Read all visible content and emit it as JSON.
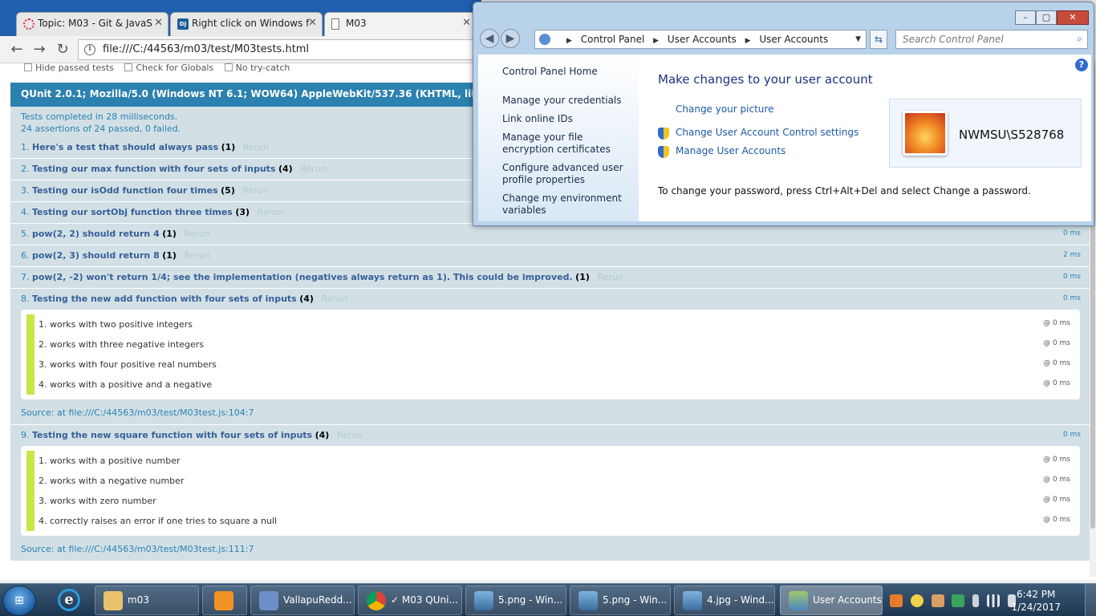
{
  "browser": {
    "tabs": [
      {
        "title": "Topic: M03 - Git & JavaS",
        "icon": "spinner-icon"
      },
      {
        "title": "Right click on Windows f",
        "icon": "dj-icon"
      },
      {
        "title": "M03",
        "icon": "page-icon"
      }
    ],
    "url": "file:///C:/44563/m03/test/M03tests.html"
  },
  "qunit": {
    "options": [
      "Hide passed tests",
      "Check for Globals",
      "No try-catch"
    ],
    "user_agent": "QUnit 2.0.1; Mozilla/5.0 (Windows NT 6.1; WOW64) AppleWebKit/537.36 (KHTML, like Gecko) Chrome/5",
    "result_line1": "Tests completed in 28 milliseconds.",
    "result_line2": "24 assertions of 24 passed, 0 failed.",
    "rerun_label": "Rerun",
    "tests": [
      {
        "idx": "1.",
        "name": "Here's a test that should always pass",
        "count": "(1)",
        "time": ""
      },
      {
        "idx": "2.",
        "name": "Testing our max function with four sets of inputs",
        "count": "(4)",
        "time": ""
      },
      {
        "idx": "3.",
        "name": "Testing our isOdd function four times",
        "count": "(5)",
        "time": ""
      },
      {
        "idx": "4.",
        "name": "Testing our sortObj function three times",
        "count": "(3)",
        "time": ""
      },
      {
        "idx": "5.",
        "name": "pow(2, 2) should return 4",
        "count": "(1)",
        "time": "0 ms"
      },
      {
        "idx": "6.",
        "name": "pow(2, 3) should return 8",
        "count": "(1)",
        "time": "2 ms"
      },
      {
        "idx": "7.",
        "name": "pow(2, -2) won't return 1/4; see the implementation (negatives always return as 1). This could be improved.",
        "count": "(1)",
        "time": "0 ms"
      },
      {
        "idx": "8.",
        "name": "Testing the new add function with four sets of inputs",
        "count": "(4)",
        "time": "0 ms",
        "assertions": [
          {
            "text": "1. works with two positive integers",
            "at": "@ 0 ms"
          },
          {
            "text": "2. works with three negative integers",
            "at": "@ 0 ms"
          },
          {
            "text": "3. works with four positive real numbers",
            "at": "@ 0 ms"
          },
          {
            "text": "4. works with a positive and a negative",
            "at": "@ 0 ms"
          }
        ],
        "source": "Source: at file:///C:/44563/m03/test/M03test.js:104:7"
      },
      {
        "idx": "9.",
        "name": "Testing the new square function with four sets of inputs",
        "count": "(4)",
        "time": "0 ms",
        "assertions": [
          {
            "text": "1. works with a positive number",
            "at": "@ 0 ms"
          },
          {
            "text": "2. works with a negative number",
            "at": "@ 0 ms"
          },
          {
            "text": "3. works with zero number",
            "at": "@ 0 ms"
          },
          {
            "text": "4. correctly raises an error if one tries to square a null",
            "at": "@ 0 ms"
          }
        ],
        "source": "Source: at file:///C:/44563/m03/test/M03test.js:111:7"
      }
    ]
  },
  "control_panel": {
    "breadcrumb": [
      "Control Panel",
      "User Accounts",
      "User Accounts"
    ],
    "search_placeholder": "Search Control Panel",
    "left_links": [
      "Control Panel Home",
      "Manage your credentials",
      "Link online IDs",
      "Manage your file encryption certificates",
      "Configure advanced user profile properties",
      "Change my environment variables"
    ],
    "title": "Make changes to your user account",
    "links": {
      "picture": "Change your picture",
      "uac": "Change User Account Control settings",
      "manage": "Manage User Accounts"
    },
    "username": "NWMSU\\S528768",
    "password_note": "To change your password, press Ctrl+Alt+Del and select Change a password."
  },
  "taskbar": {
    "items": [
      {
        "label": "m03",
        "icon": "folder-icon"
      },
      {
        "label": "",
        "icon": "media-player-icon"
      },
      {
        "label": "VallapuRedd...",
        "icon": "virtualbox-icon"
      },
      {
        "label": "✓ M03 QUni...",
        "icon": "chrome-icon"
      },
      {
        "label": "5.png - Win...",
        "icon": "photo-viewer-icon"
      },
      {
        "label": "5.png - Win...",
        "icon": "photo-viewer-icon"
      },
      {
        "label": "4.jpg - Wind...",
        "icon": "photo-viewer-icon"
      },
      {
        "label": "User Accounts",
        "icon": "user-accounts-icon"
      }
    ],
    "time": "6:42 PM",
    "date": "1/24/2017"
  }
}
